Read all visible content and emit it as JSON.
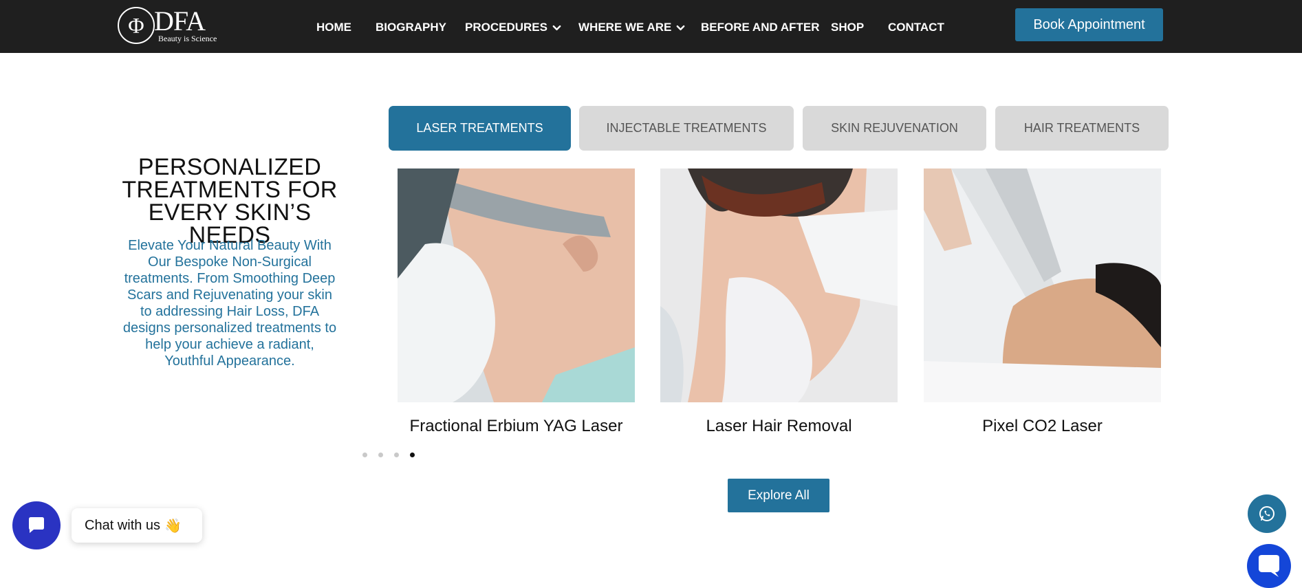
{
  "header": {
    "logo": {
      "brand": "DFA",
      "tagline": "Beauty is Science",
      "monogram": "Φ"
    },
    "nav": [
      {
        "label": "HOME",
        "has_dropdown": false
      },
      {
        "label": "BIOGRAPHY",
        "has_dropdown": false
      },
      {
        "label": "PROCEDURES",
        "has_dropdown": true
      },
      {
        "label": "WHERE WE ARE",
        "has_dropdown": true
      },
      {
        "label": "BEFORE AND AFTER",
        "has_dropdown": false
      },
      {
        "label": "SHOP",
        "has_dropdown": false
      },
      {
        "label": "CONTACT",
        "has_dropdown": false
      }
    ],
    "book_label": "Book Appointment"
  },
  "hero": {
    "headline": "PERSONALIZED TREATMENTS FOR EVERY SKIN’S NEEDS",
    "intro": "Elevate Your Natural Beauty With Our Bespoke Non-Surgical treatments. From Smoothing Deep Scars and Rejuvenating your skin to addressing Hair Loss, DFA designs personalized treatments to help your achieve a radiant, Youthful Appearance."
  },
  "tabs": [
    {
      "label": "LASER TREATMENTS",
      "active": true
    },
    {
      "label": "INJECTABLE TREATMENTS",
      "active": false
    },
    {
      "label": "SKIN REJUVENATION",
      "active": false
    },
    {
      "label": "HAIR TREATMENTS",
      "active": false
    }
  ],
  "cards": [
    {
      "title": "Fractional Erbium YAG Laser"
    },
    {
      "title": "Laser Hair Removal"
    },
    {
      "title": "Pixel CO2 Laser"
    }
  ],
  "carousel": {
    "pages": 4,
    "active_page": 4
  },
  "explore_label": "Explore All",
  "chat": {
    "label": "Chat with us",
    "emoji": "👋"
  },
  "colors": {
    "header_bg": "#1f1f1f",
    "accent": "#23729b",
    "tab_inactive": "#d9d9d9",
    "chat_launcher": "#2a33c2",
    "messenger": "#1446d8"
  },
  "icons": {
    "dropdown": "chevron-down-icon",
    "chat": "chat-bubble-icon",
    "whatsapp": "whatsapp-icon",
    "messenger": "messenger-icon"
  }
}
